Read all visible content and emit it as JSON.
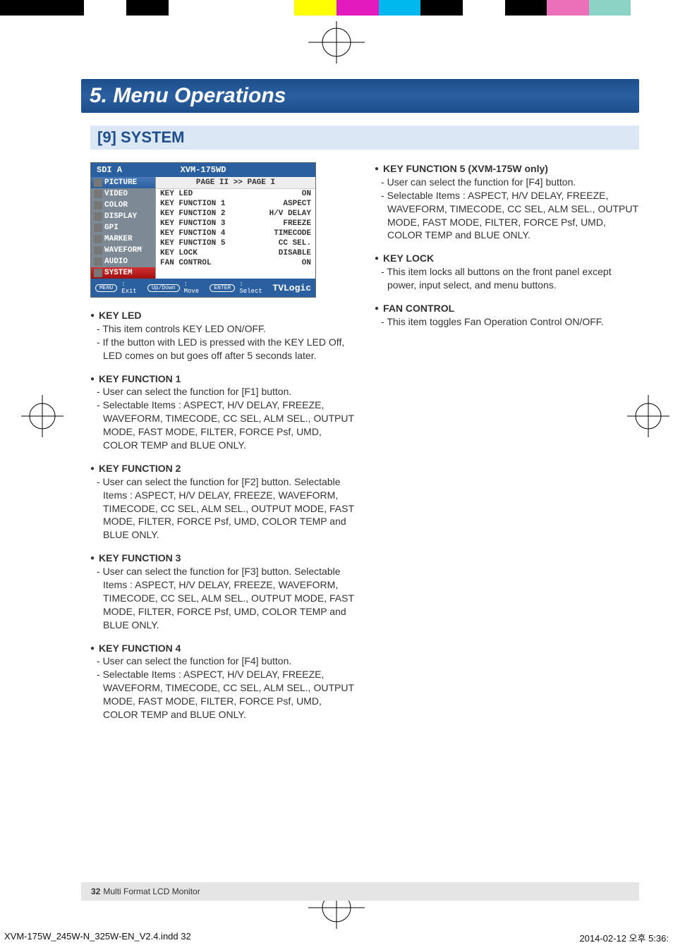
{
  "colorbar": [
    "#000000",
    "#000000",
    "#ffffff",
    "#000000",
    "#ffffff",
    "#ffffff",
    "#ffffff",
    "#ffff00",
    "#e31bbf",
    "#00b8ee",
    "#000000",
    "#ffffff",
    "#000000",
    "#ec6fb9",
    "#8cd3c6",
    "#ffffff"
  ],
  "title": "5. Menu Operations",
  "section": "[9] SYSTEM",
  "osd": {
    "header_left": "SDI A",
    "header_center": "XVM-175WD",
    "sidebar": [
      {
        "label": "PICTURE",
        "cls": "si-picture"
      },
      {
        "label": "VIDEO",
        "cls": "si-video"
      },
      {
        "label": "COLOR",
        "cls": "si-color"
      },
      {
        "label": "DISPLAY",
        "cls": "si-display"
      },
      {
        "label": "GPI",
        "cls": "si-gpi"
      },
      {
        "label": "MARKER",
        "cls": "si-marker"
      },
      {
        "label": "WAVEFORM",
        "cls": "si-waveform"
      },
      {
        "label": "AUDIO",
        "cls": "si-audio"
      },
      {
        "label": "SYSTEM",
        "cls": "si-system"
      }
    ],
    "page_tabs": "PAGE II >> PAGE I",
    "rows": [
      {
        "l": "KEY LED",
        "r": "ON"
      },
      {
        "l": "KEY FUNCTION 1",
        "r": "ASPECT"
      },
      {
        "l": "KEY FUNCTION 2",
        "r": "H/V DELAY"
      },
      {
        "l": "KEY FUNCTION 3",
        "r": "FREEZE"
      },
      {
        "l": "KEY FUNCTION 4",
        "r": "TIMECODE"
      },
      {
        "l": "KEY FUNCTION 5",
        "r": "CC SEL."
      },
      {
        "l": "KEY LOCK",
        "r": "DISABLE"
      },
      {
        "l": "FAN CONTROL",
        "r": "ON"
      }
    ],
    "footer": {
      "menu": "MENU",
      "menu_t": ": Exit",
      "updown": "Up/Down",
      "updown_t": ": Move",
      "enter": "ENTER",
      "enter_t": ": Select",
      "brand": "TVLogic"
    }
  },
  "left_items": [
    {
      "title": "KEY LED",
      "lines": [
        "This item controls KEY LED ON/OFF.",
        "If the button with LED is pressed with the KEY LED Off, LED comes on but goes off after 5 seconds later."
      ]
    },
    {
      "title": "KEY FUNCTION 1",
      "lines": [
        "User can select the function for [F1] button.",
        "Selectable Items : ASPECT, H/V DELAY, FREEZE, WAVEFORM, TIMECODE, CC SEL, ALM SEL., OUTPUT MODE, FAST MODE, FILTER, FORCE Psf, UMD, COLOR TEMP and BLUE ONLY."
      ]
    },
    {
      "title": "KEY FUNCTION 2",
      "lines": [
        "User can select the function for [F2] button. Selectable Items : ASPECT, H/V DELAY, FREEZE, WAVEFORM, TIMECODE, CC SEL, ALM SEL., OUTPUT MODE, FAST MODE, FILTER, FORCE Psf, UMD, COLOR TEMP and BLUE ONLY."
      ]
    },
    {
      "title": "KEY FUNCTION 3",
      "lines": [
        "User can select the function for [F3] button. Selectable Items : ASPECT, H/V DELAY, FREEZE, WAVEFORM, TIMECODE, CC SEL, ALM SEL., OUTPUT MODE, FAST MODE, FILTER, FORCE Psf, UMD, COLOR TEMP and BLUE ONLY."
      ]
    },
    {
      "title": "KEY FUNCTION 4",
      "lines": [
        "User can select the function for [F4] button.",
        "Selectable Items : ASPECT, H/V DELAY, FREEZE, WAVEFORM, TIMECODE, CC SEL, ALM SEL., OUTPUT MODE, FAST MODE, FILTER, FORCE Psf, UMD, COLOR TEMP and BLUE ONLY."
      ]
    }
  ],
  "right_items": [
    {
      "title": "KEY FUNCTION 5 (XVM-175W only)",
      "lines": [
        "User can select the function for [F4] button.",
        "Selectable Items : ASPECT, H/V DELAY, FREEZE, WAVEFORM, TIMECODE, CC SEL, ALM SEL., OUTPUT MODE, FAST MODE, FILTER, FORCE Psf, UMD, COLOR TEMP and BLUE ONLY."
      ]
    },
    {
      "title": "KEY LOCK",
      "lines": [
        "This item locks all buttons on the front panel except power, input select, and menu buttons."
      ]
    },
    {
      "title": "FAN CONTROL",
      "lines": [
        "This item toggles Fan Operation Control ON/OFF."
      ]
    }
  ],
  "footer_page": {
    "num": "32",
    "label": "Multi Format LCD Monitor"
  },
  "print": {
    "file": "XVM-175W_245W-N_325W-EN_V2.4.indd   32",
    "date": "2014-02-12   오후 5:36:"
  }
}
